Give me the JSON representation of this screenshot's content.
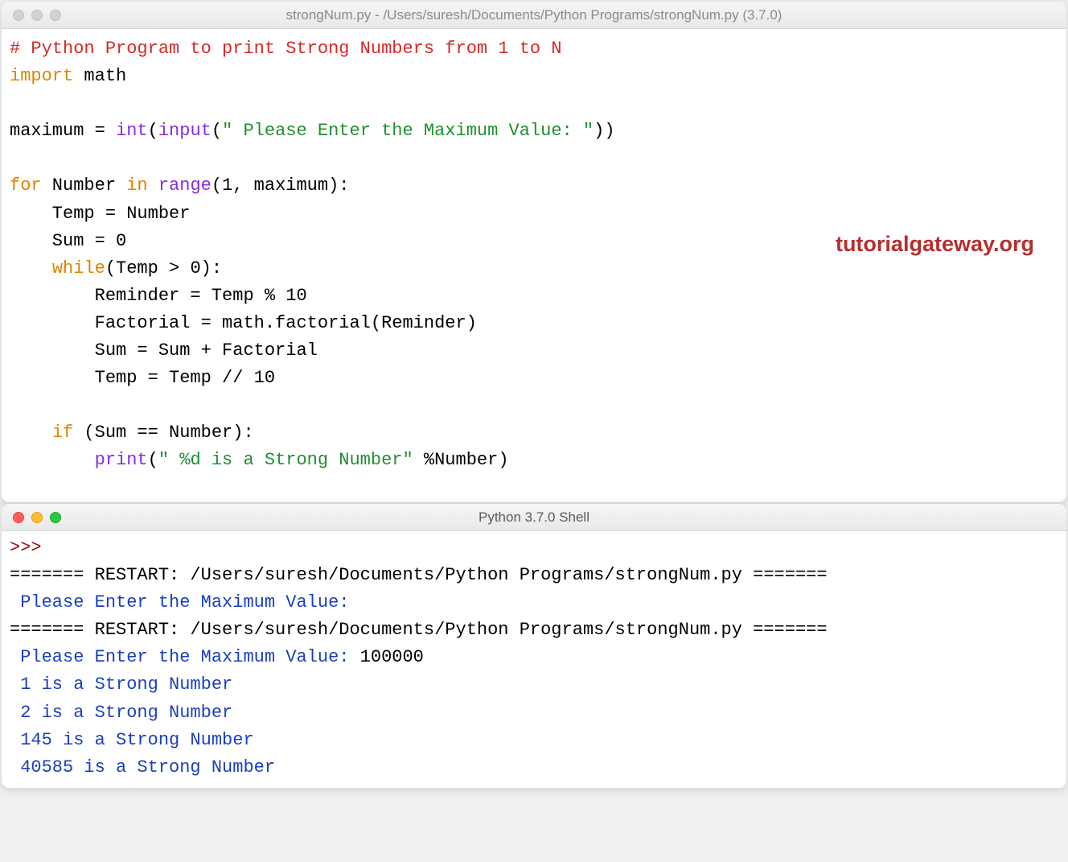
{
  "editor": {
    "title": "strongNum.py - /Users/suresh/Documents/Python Programs/strongNum.py (3.7.0)",
    "line1_comment": "# Python Program to print Strong Numbers from 1 to N",
    "kw_import": "import",
    "mod_math": " math",
    "l4_a": "maximum = ",
    "l4_int": "int",
    "l4_b": "(",
    "l4_input": "input",
    "l4_c": "(",
    "l4_str": "\" Please Enter the Maximum Value: \"",
    "l4_d": "))",
    "l6_for": "for",
    "l6_a": " Number ",
    "l6_in": "in",
    "l6_b": " ",
    "l6_range": "range",
    "l6_c": "(",
    "l6_num1": "1",
    "l6_d": ", maximum):",
    "l7": "    Temp = Number",
    "l8_a": "    Sum = ",
    "l8_0": "0",
    "l9_indent": "    ",
    "l9_while": "while",
    "l9_a": "(Temp > ",
    "l9_0": "0",
    "l9_b": "):",
    "l10_a": "        Reminder = Temp % ",
    "l10_10": "10",
    "l11": "        Factorial = math.factorial(Reminder)",
    "l12": "        Sum = Sum + Factorial",
    "l13_a": "        Temp = Temp // ",
    "l13_10": "10",
    "l15_indent": "    ",
    "l15_if": "if",
    "l15_a": " (Sum == Number):",
    "l16_indent": "        ",
    "l16_print": "print",
    "l16_a": "(",
    "l16_str": "\" %d is a Strong Number\"",
    "l16_b": " %Number)",
    "watermark": "tutorialgateway.org"
  },
  "shell": {
    "title": "Python 3.7.0 Shell",
    "prompt": ">>> ",
    "restart1": "======= RESTART: /Users/suresh/Documents/Python Programs/strongNum.py =======",
    "ask1": " Please Enter the Maximum Value: ",
    "restart2": "======= RESTART: /Users/suresh/Documents/Python Programs/strongNum.py =======",
    "ask2a": " Please Enter the Maximum Value: ",
    "ask2b": "100000",
    "out1": " 1 is a Strong Number",
    "out2": " 2 is a Strong Number",
    "out3": " 145 is a Strong Number",
    "out4": " 40585 is a Strong Number"
  }
}
